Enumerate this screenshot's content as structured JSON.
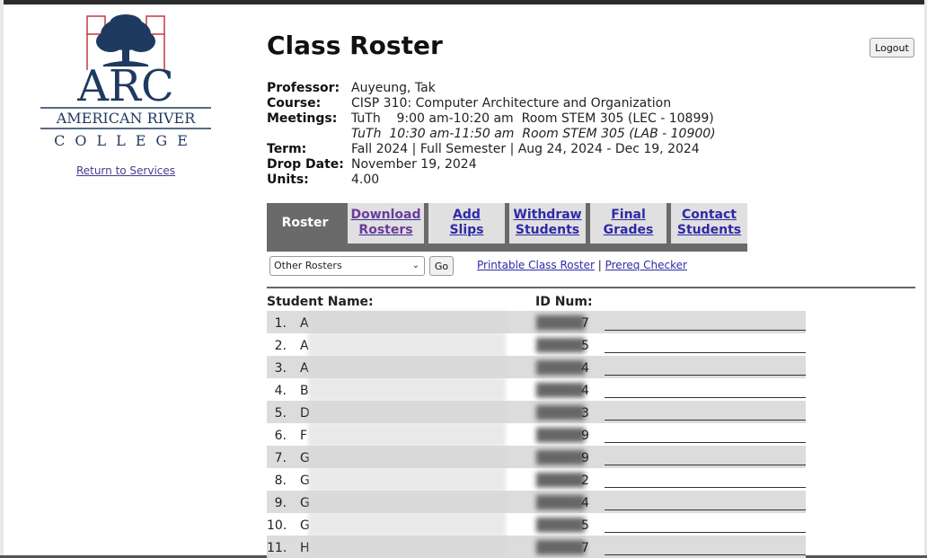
{
  "sidebar": {
    "logo_top": "ARC",
    "logo_line1": "AMERICAN RIVER",
    "logo_line2": "COLLEGE",
    "return_link": "Return to Services"
  },
  "header": {
    "title": "Class Roster",
    "logout_label": "Logout"
  },
  "info": {
    "professor_label": "Professor:",
    "professor": "Auyeung, Tak",
    "course_label": "Course:",
    "course": "CISP 310: Computer Architecture and Organization",
    "meetings_label": "Meetings:",
    "meeting1": "TuTh    9:00 am-10:20 am  Room STEM 305 (LEC - 10899)",
    "meeting2": "TuTh  10:30 am-11:50 am  Room STEM 305 (LAB - 10900)",
    "term_label": "Term:",
    "term": "Fall 2024 | Full Semester | Aug 24, 2024 - Dec 19, 2024",
    "drop_label": "Drop Date:",
    "drop_date": "November 19, 2024",
    "units_label": "Units:",
    "units": "4.00"
  },
  "tabs": [
    {
      "line1": "Roster",
      "line2": ""
    },
    {
      "line1": "Download",
      "line2": "Rosters"
    },
    {
      "line1": "Add",
      "line2": "Slips"
    },
    {
      "line1": "Withdraw",
      "line2": "Students"
    },
    {
      "line1": "Final",
      "line2": "Grades"
    },
    {
      "line1": "Contact",
      "line2": "Students"
    }
  ],
  "controls": {
    "select_value": "Other Rosters",
    "go_label": "Go",
    "printable_link": "Printable Class Roster",
    "separator": "|",
    "prereq_link": "Prereq Checker"
  },
  "table": {
    "name_header": "Student Name:",
    "id_header": "ID Num:",
    "rows": [
      {
        "num": "1.",
        "first": "A",
        "id_last": "7"
      },
      {
        "num": "2.",
        "first": "A",
        "id_last": "5"
      },
      {
        "num": "3.",
        "first": "A",
        "id_last": "4"
      },
      {
        "num": "4.",
        "first": "B",
        "id_last": "4"
      },
      {
        "num": "5.",
        "first": "D",
        "id_last": "3"
      },
      {
        "num": "6.",
        "first": "F",
        "id_last": "9"
      },
      {
        "num": "7.",
        "first": "G",
        "id_last": "9"
      },
      {
        "num": "8.",
        "first": "G",
        "id_last": "2"
      },
      {
        "num": "9.",
        "first": "G",
        "id_last": "4"
      },
      {
        "num": "10.",
        "first": "G",
        "id_last": "5"
      },
      {
        "num": "11.",
        "first": "H",
        "id_last": "7"
      }
    ]
  },
  "colors": {
    "logo_navy": "#1f3a5f",
    "logo_red": "#c23b3b",
    "tab_bar": "#6a6a6a",
    "link": "#2f2aa8"
  }
}
